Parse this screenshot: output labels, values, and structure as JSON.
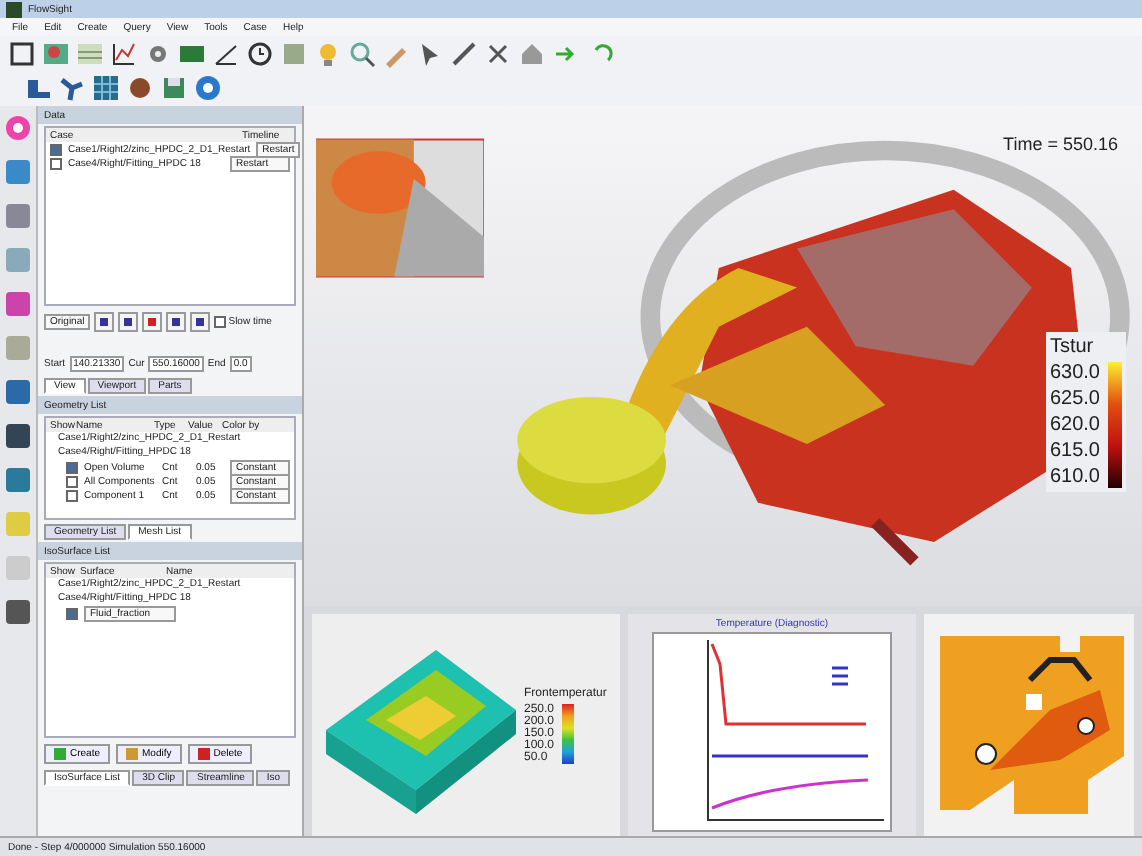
{
  "window": {
    "title": "FlowSight"
  },
  "menu": [
    "File",
    "Edit",
    "Create",
    "Query",
    "View",
    "Tools",
    "Case",
    "Help"
  ],
  "case_panel": {
    "title": "Data",
    "columns": [
      "Case",
      "Timeline"
    ],
    "rows": [
      {
        "case": "Case1/Right2/zinc_HPDC_2_D1_Restart",
        "timeline": "Restart",
        "checked": true
      },
      {
        "case": "Case4/Right/Fitting_HPDC 18",
        "timeline": "Restart",
        "checked": false
      }
    ],
    "mode": "Original",
    "slow_time": {
      "label": "Slow time",
      "checked": false
    },
    "fields": [
      {
        "label": "Start",
        "value": "140.21330"
      },
      {
        "label": "Cur",
        "value": "550.16000"
      },
      {
        "label": "End",
        "value": "0.0"
      }
    ],
    "tabs": [
      {
        "label": "View",
        "selected": true
      },
      {
        "label": "Viewport",
        "selected": false
      },
      {
        "label": "Parts",
        "selected": false
      }
    ]
  },
  "geometry_panel": {
    "title": "Geometry List",
    "columns": [
      "Show",
      "Name",
      "Type",
      "Value",
      "Color by"
    ],
    "cases": [
      "Case1/Right2/zinc_HPDC_2_D1_Restart",
      "Case4/Right/Fitting_HPDC 18"
    ],
    "rows": [
      {
        "name": "Open Volume",
        "type": "Cnt",
        "value": "0.05",
        "color_by": "Constant",
        "checked": true
      },
      {
        "name": "All Components",
        "type": "Cnt",
        "value": "0.05",
        "color_by": "Constant",
        "checked": false
      },
      {
        "name": "Component 1",
        "type": "Cnt",
        "value": "0.05",
        "color_by": "Constant",
        "checked": false
      }
    ],
    "tabs": [
      {
        "label": "Geometry List",
        "selected": false
      },
      {
        "label": "Mesh List",
        "selected": true
      }
    ]
  },
  "iso_panel": {
    "title": "IsoSurface List",
    "columns": [
      "Show",
      "Surface",
      "Name"
    ],
    "cases": [
      "Case1/Right2/zinc_HPDC_2_D1_Restart",
      "Case4/Right/Fitting_HPDC 18"
    ],
    "rows": [
      {
        "surface": "Fluid_fraction",
        "checked": true
      }
    ],
    "buttons": [
      "Create",
      "Modify",
      "Delete"
    ],
    "tabs": [
      {
        "label": "IsoSurface List",
        "selected": true
      },
      {
        "label": "3D Clip",
        "selected": false
      },
      {
        "label": "Streamline",
        "selected": false
      },
      {
        "label": "Iso",
        "selected": false
      }
    ]
  },
  "viewport": {
    "time": "Time = 550.16",
    "legend": {
      "title": "Tstur",
      "ticks": [
        "630.0",
        "625.0",
        "620.0",
        "615.0",
        "610.0"
      ]
    }
  },
  "thumbnails": {
    "legend": {
      "title": "Frontemperatur",
      "ticks": [
        "250.0",
        "200.0",
        "150.0",
        "100.0",
        "50.0"
      ]
    },
    "chart_title": "Temperature (Diagnostic)"
  },
  "status_bar": "Done - Step 4/000000 Simulation 550.16000"
}
